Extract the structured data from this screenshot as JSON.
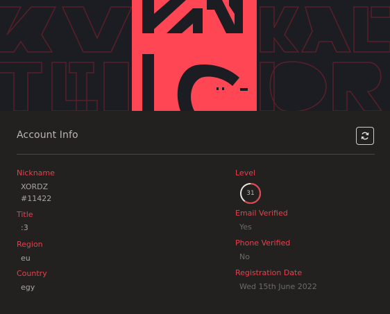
{
  "panel": {
    "title": "Account Info",
    "refresh_icon": "refresh-icon"
  },
  "fields": {
    "nickname": {
      "label": "Nickname",
      "value_line1": "XORDZ",
      "value_line2": "#11422"
    },
    "title": {
      "label": "Title",
      "value": ":3"
    },
    "region": {
      "label": "Region",
      "value": "eu"
    },
    "country": {
      "label": "Country",
      "value": "egy"
    },
    "level": {
      "label": "Level",
      "value": "31",
      "progress_fraction": 0.6
    },
    "email_verified": {
      "label": "Email Verified",
      "value": "Yes"
    },
    "phone_verified": {
      "label": "Phone Verified",
      "value": "No"
    },
    "registration_date": {
      "label": "Registration Date",
      "value": "Wed 15th June 2022"
    }
  },
  "colors": {
    "accent": "#e3424e",
    "banner_bg": "#1c1d22",
    "card_bg": "#232120",
    "logo_red": "#ff4655"
  }
}
